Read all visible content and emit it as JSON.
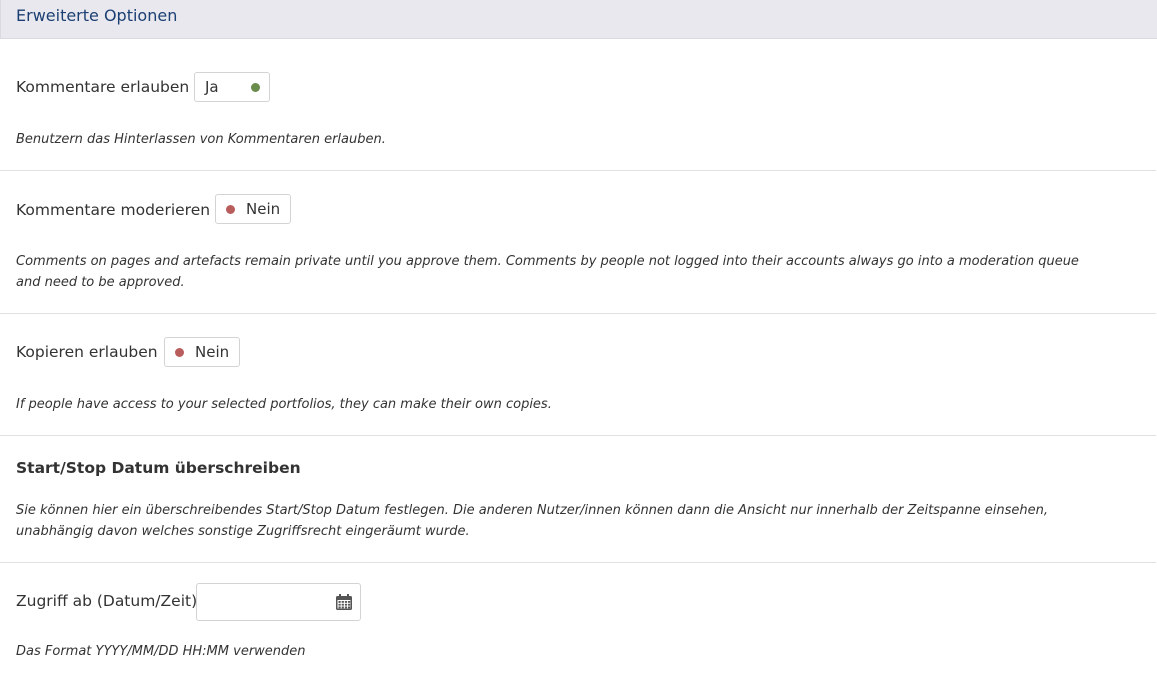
{
  "panel": {
    "title": "Erweiterte Optionen"
  },
  "comments": {
    "label": "Kommentare erlauben",
    "toggle_value": "Ja",
    "description": "Benutzern das Hinterlassen von Kommentaren erlauben."
  },
  "moderate": {
    "label": "Kommentare moderieren",
    "toggle_value": "Nein",
    "description": "Comments on pages and artefacts remain private until you approve them. Comments by people not logged into their accounts always go into a moderation queue and need to be approved."
  },
  "copy": {
    "label": "Kopieren erlauben",
    "toggle_value": "Nein",
    "description": "If people have access to your selected portfolios, they can make their own copies."
  },
  "override": {
    "heading": "Start/Stop Datum überschreiben",
    "description": "Sie können hier ein überschreibendes Start/Stop Datum festlegen. Die anderen Nutzer/innen können dann die Ansicht nur innerhalb der Zeitspanne einsehen, unabhängig davon welches sonstige Zugriffsrecht eingeräumt wurde."
  },
  "access_from": {
    "label": "Zugriff ab (Datum/Zeit)",
    "value": "",
    "icon": "calendar-icon",
    "hint": "Das Format YYYY/MM/DD HH:MM verwenden"
  },
  "colors": {
    "on": "#6a8c4c",
    "off": "#b95c5c",
    "title": "#1c3f73"
  }
}
